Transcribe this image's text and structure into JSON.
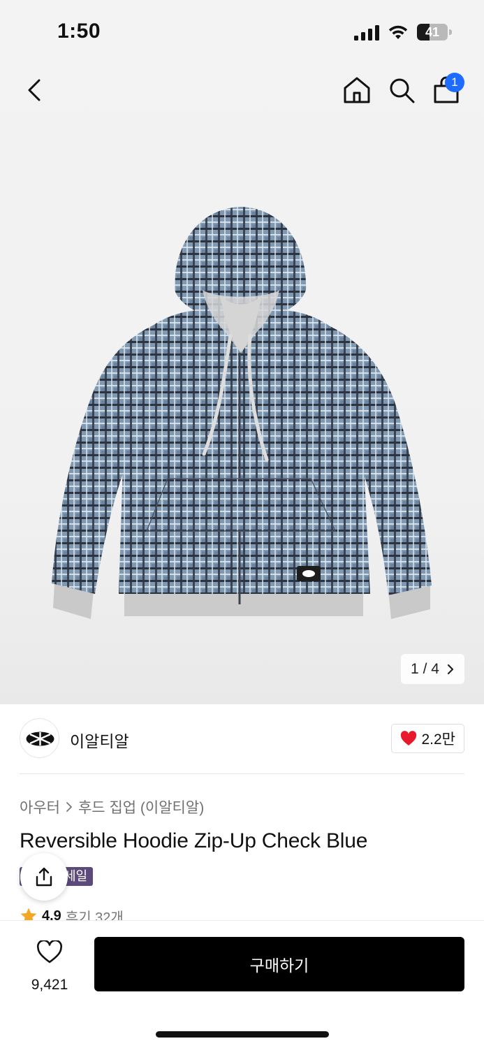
{
  "status_bar": {
    "time": "1:50",
    "battery": "41",
    "battery_level": 0.41
  },
  "nav": {
    "cart_badge": "1"
  },
  "gallery": {
    "current": "1",
    "separator": "/",
    "total": "4"
  },
  "brand": {
    "name": "이알티알",
    "likes": "2.2만"
  },
  "breadcrumb": {
    "category": "아우터",
    "subcategory": "후드 집업 (이알티알)"
  },
  "product": {
    "title": "Reversible Hoodie Zip-Up Check Blue",
    "sale_badge": "세일"
  },
  "rating": {
    "value": "4.9",
    "reviews": "후기 32개"
  },
  "bottom": {
    "wish_count": "9,421",
    "buy_label": "구매하기"
  },
  "colors": {
    "accent_badge": "#1e6bff",
    "heart": "#e8192c",
    "star": "#f5a623",
    "sale_badge": "#5b4a7a"
  },
  "icons": [
    "signal-icon",
    "wifi-icon",
    "back-arrow-icon",
    "home-icon",
    "search-icon",
    "cart-icon",
    "chevron-right-icon",
    "heart-filled-icon",
    "share-icon",
    "star-icon",
    "heart-outline-icon"
  ]
}
